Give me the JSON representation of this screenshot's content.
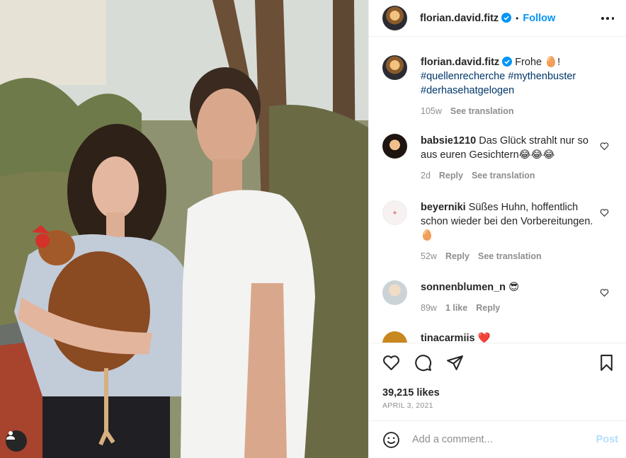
{
  "post": {
    "username": "florian.david.fitz",
    "follow_label": "Follow",
    "dot": "•"
  },
  "caption": {
    "username": "florian.david.fitz",
    "text": "Frohe 🥚!",
    "hashtags": "#quellenrecherche #mythenbuster #derhasehatgelogen",
    "age": "105w",
    "see_translation": "See translation"
  },
  "comments": [
    {
      "username": "babsie1210",
      "text": "Das Glück strahlt nur so aus euren Gesichtern😂😂😂",
      "age": "2d",
      "reply": "Reply",
      "see_translation": "See translation"
    },
    {
      "username": "beyerniki",
      "text": "Süßes Huhn, hoffentlich schon wieder bei den Vorbereitungen. 🥚",
      "age": "52w",
      "reply": "Reply",
      "see_translation": "See translation"
    },
    {
      "username": "sonnenblumen_n",
      "text": "😎",
      "age": "89w",
      "likes": "1 like",
      "reply": "Reply"
    },
    {
      "username": "tinacarmiis",
      "text": "❤️"
    }
  ],
  "footer": {
    "likes": "39,215 likes",
    "date": "APRIL 3, 2021",
    "comment_placeholder": "Add a comment...",
    "post_label": "Post"
  },
  "icons": {
    "verified": "verified-badge-icon",
    "more": "more-options-icon",
    "like": "heart-icon",
    "comment": "comment-icon",
    "share": "share-icon",
    "save": "bookmark-icon",
    "emoji": "emoji-icon",
    "user_tag": "user-tag-icon"
  },
  "colors": {
    "accent": "#0095f6",
    "hashtag": "#00376b",
    "muted": "#8e8e8e",
    "post_disabled": "#b2dffc"
  }
}
